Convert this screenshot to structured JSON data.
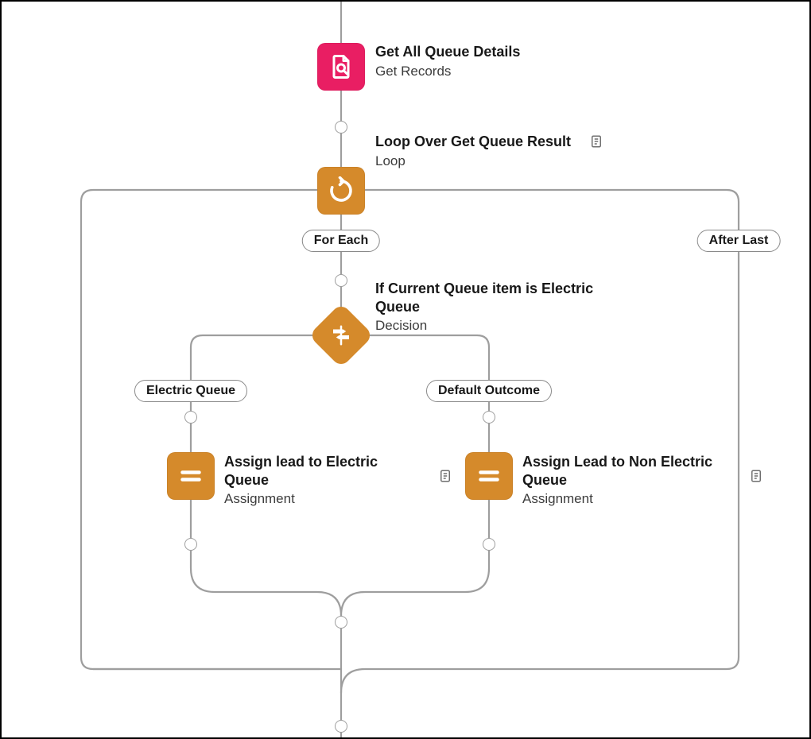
{
  "colors": {
    "pink": "#e91e63",
    "orange": "#d58a2b",
    "line": "#9e9e9e"
  },
  "nodes": {
    "getRecords": {
      "title": "Get All Queue Details",
      "sub": "Get Records"
    },
    "loop": {
      "title": "Loop Over Get Queue Result",
      "sub": "Loop"
    },
    "decision": {
      "title": "If Current Queue item is Electric Queue",
      "sub": "Decision"
    },
    "assignElectric": {
      "title": "Assign lead to Electric Queue",
      "sub": "Assignment"
    },
    "assignNonElectric": {
      "title": "Assign Lead to Non Electric Queue",
      "sub": "Assignment"
    }
  },
  "badges": {
    "forEach": "For Each",
    "afterLast": "After Last",
    "electric": "Electric Queue",
    "default": "Default Outcome"
  }
}
